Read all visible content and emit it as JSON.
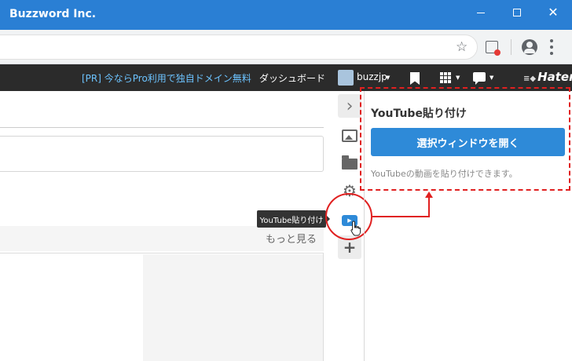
{
  "window": {
    "title": "Buzzword Inc.",
    "min_icon": "minimize-icon",
    "max_icon": "maximize-icon",
    "close_glyph": "✕"
  },
  "toolbar": {
    "star_glyph": "☆",
    "icons": [
      "star-icon",
      "extension-icon",
      "account-icon",
      "menu-icon"
    ]
  },
  "header": {
    "pr_text": "[PR] 今ならPro利用で独自ドメイン無料",
    "dashboard": "ダッシュボード",
    "username": "buzzjp",
    "caret": "▼",
    "logo_symbol": "≡◆",
    "logo": "Hatena",
    "colors": {
      "bar": "#2b2b2b",
      "pr_link": "#6cc3ff"
    }
  },
  "editor": {
    "more_link": "もっと見る"
  },
  "sidebar": {
    "chevron_glyph": "›",
    "gear_glyph": "⚙",
    "plus_glyph": "+",
    "play_glyph": "▶",
    "tooltip": "YouTube貼り付け",
    "icons": [
      "chevron-right-icon",
      "image-icon",
      "folder-icon",
      "gear-icon",
      "youtube-icon",
      "plus-icon"
    ]
  },
  "panel": {
    "title": "YouTube貼り付け",
    "button": "選択ウィンドウを開く",
    "description": "YouTubeの動画を貼り付けできます。",
    "accent": "#2e8ad8"
  },
  "highlight": {
    "color": "#e02020"
  }
}
